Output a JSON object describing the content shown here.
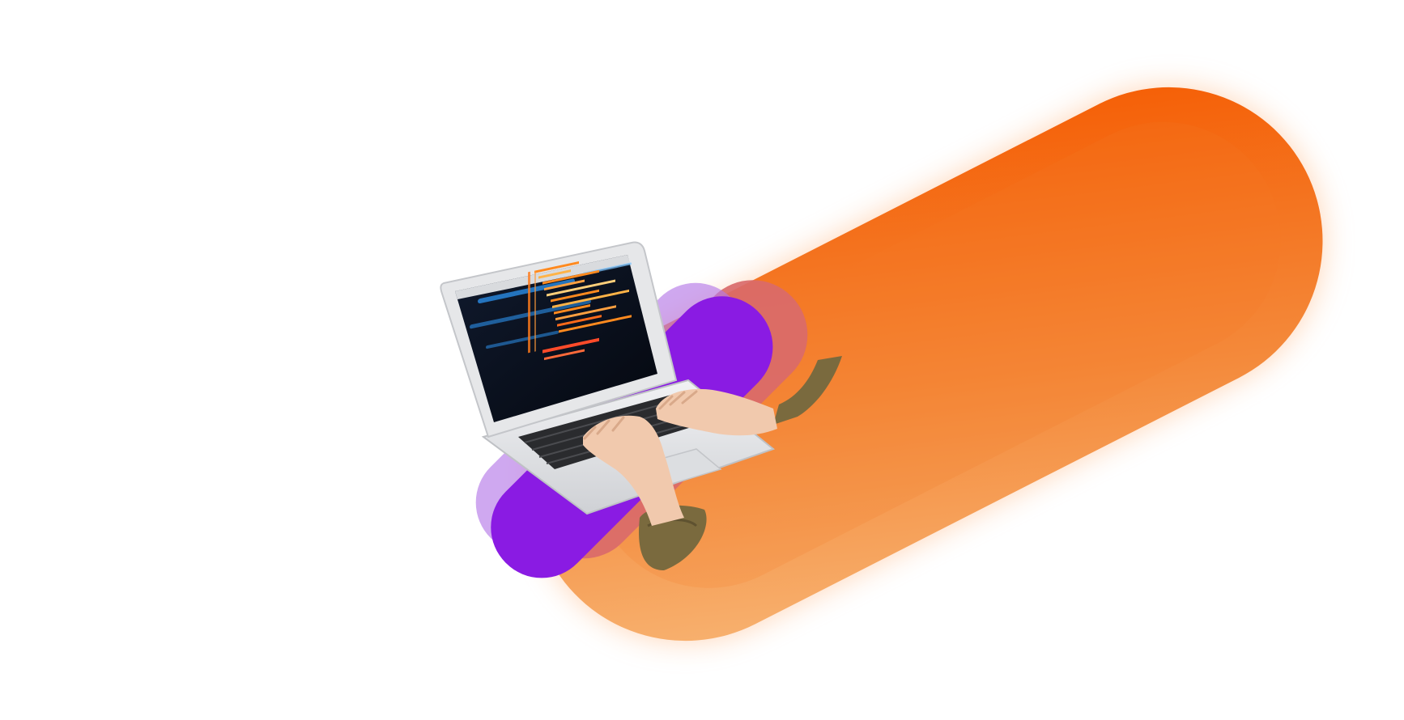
{
  "scene": {
    "description_icon": "laptop-coding-illustration-icon",
    "colors": {
      "background": "#ffffff",
      "orange_light": "#f6b26b",
      "orange_mid": "#f47b20",
      "orange_dark": "#f55a00",
      "purple": "#8a1be3",
      "purple_light": "#b57ae8",
      "rose": "#d96a6a",
      "laptop_silver": "#e6e7e9",
      "screen_dark": "#0b1120",
      "code_orange": "#ff8a1f",
      "code_blue": "#2f9dff",
      "sleeve": "#7a6a3e",
      "skin": "#f1c9ad"
    }
  }
}
